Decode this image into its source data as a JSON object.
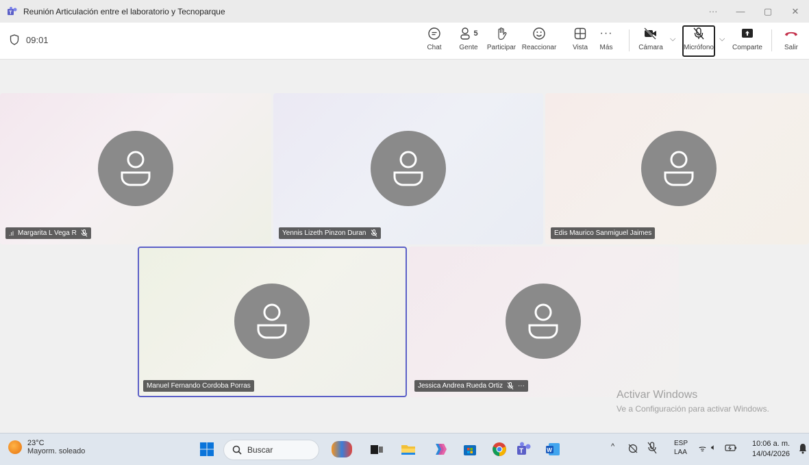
{
  "window": {
    "title": "Reunión Articulación entre el laboratorio y Tecnoparque",
    "controls": [
      "···",
      "—",
      "▢",
      "✕"
    ]
  },
  "toolbar": {
    "timer": "09:01",
    "people_count": "5",
    "buttons": {
      "chat": "Chat",
      "people": "Gente",
      "raise": "Participar",
      "react": "Reaccionar",
      "view": "Vista",
      "more": "Más",
      "camera": "Cámara",
      "mic": "Micrófono",
      "share": "Comparte",
      "leave": "Salir"
    },
    "accent": "#5b5fc7",
    "leave_color": "#c4314b"
  },
  "participants": [
    {
      "name": "Margarita L Vega R",
      "muted": true,
      "signal": true
    },
    {
      "name": "Yennis Lizeth Pinzon Duran",
      "muted": true
    },
    {
      "name": "Edis Maurico Sanmiguel Jaimes",
      "muted": false
    },
    {
      "name": "Manuel Fernando Cordoba Porras",
      "muted": false,
      "active_speaker": true
    },
    {
      "name": "Jessica Andrea Rueda Ortiz",
      "muted": true,
      "more": "···"
    }
  ],
  "watermark": {
    "line1": "Activar Windows",
    "line2": "Ve a Configuración para activar Windows."
  },
  "taskbar": {
    "weather_temp": "23°C",
    "weather_desc": "Mayorm. soleado",
    "search_placeholder": "Buscar",
    "lang_top": "ESP",
    "lang_bottom": "LAA",
    "time": "10:06 a. m.",
    "date": "14/04/2026"
  }
}
